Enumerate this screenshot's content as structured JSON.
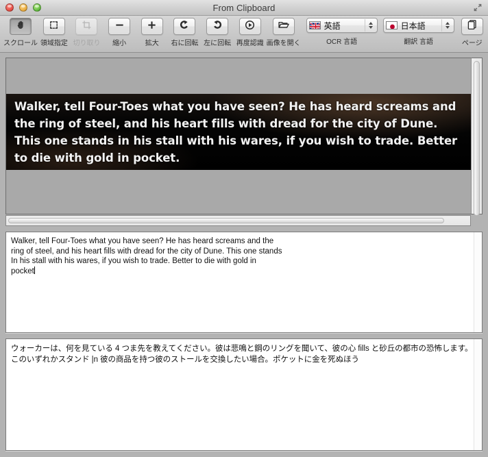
{
  "window": {
    "title": "From Clipboard",
    "controls": {
      "close": "close-button",
      "minimize": "minimize-button",
      "zoom": "zoom-button"
    },
    "fullscreen_label": "Enter Full Screen"
  },
  "toolbar": {
    "items": [
      {
        "label": "スクロール",
        "icon": "hand-icon",
        "state": "pressed"
      },
      {
        "label": "領域指定",
        "icon": "selection-marquee-icon",
        "state": "normal"
      },
      {
        "label": "切り取り",
        "icon": "crop-icon",
        "state": "disabled"
      },
      {
        "label": "縮小",
        "icon": "minus-icon",
        "state": "normal"
      },
      {
        "label": "拡大",
        "icon": "plus-icon",
        "state": "normal"
      },
      {
        "label": "右に回転",
        "icon": "rotate-right-icon",
        "state": "normal"
      },
      {
        "label": "左に回転",
        "icon": "rotate-left-icon",
        "state": "normal"
      },
      {
        "label": "再度認識",
        "icon": "recognize-play-icon",
        "state": "normal"
      },
      {
        "label": "画像を開く",
        "icon": "open-folder-icon",
        "state": "normal"
      }
    ],
    "ocr_language": {
      "group_label": "OCR 言語",
      "value": "英語",
      "flag": "uk-flag-icon"
    },
    "translate_language": {
      "group_label": "翻訳 言語",
      "value": "日本語",
      "flag": "japan-flag-icon"
    },
    "page": {
      "label": "ページ",
      "icon": "pages-icon"
    }
  },
  "image_pane": {
    "banner_text": "Walker, tell Four-Toes what you have seen? He has heard screams and the ring of steel, and his heart fills with dread for the city of Dune. This one stands in his stall with his wares, if you wish to trade. Better to die with gold in pocket."
  },
  "ocr_pane": {
    "text": "Walker, tell Four-Toes what you have seen? He has heard screams and the\nring of steel, and his heart fills with dread for the city of Dune. This one stands\nIn his stall with his wares, if you wish to trade. Better to die with gold in\npocket"
  },
  "translation_pane": {
    "text": "ウォーカーは、何を見ている 4 つま先を教えてください。彼は悲鳴と鋼のリングを聞いて、彼の心 fills と砂丘の都市の恐怖します。\nこのいずれかスタンド |n 彼の商品を持つ彼のストールを交換したい場合。ポケットに金を死ぬほう"
  },
  "colors": {
    "window_bg": "#b3b3b3",
    "toolbar_bg": "#cacaca",
    "banner_bg": "#000000",
    "text_pane_bg": "#ffffff",
    "accent_close": "#e24b42",
    "accent_min": "#e8a93b",
    "accent_max": "#5eb83c"
  }
}
